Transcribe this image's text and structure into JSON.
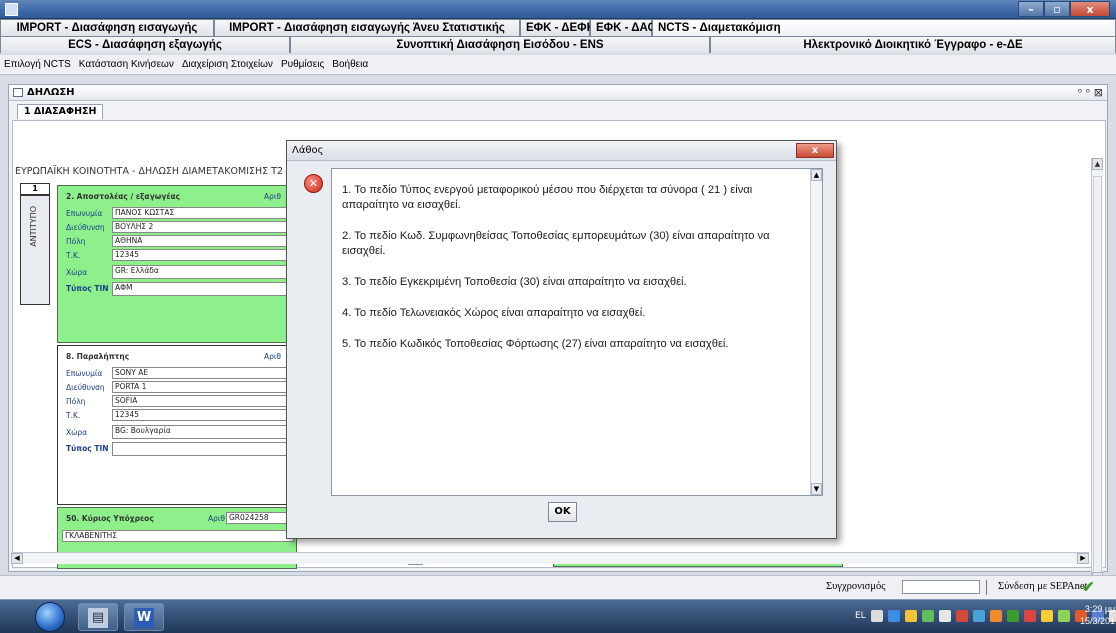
{
  "window": {
    "controls": [
      "–",
      "▫",
      "x"
    ]
  },
  "tabs_row1": [
    "IMPORT - Διασάφηση εισαγωγής",
    "IMPORT - Διασάφηση εισαγωγής Άνευ Στατιστικής",
    "ΕΦΚ - ΔΕΦΚ",
    "ΕΦΚ - ΔΑΟ",
    "NCTS - Διαμετακόμιση"
  ],
  "tabs_row2": [
    "ECS - Διασάφηση εξαγωγής",
    "Συνοπτική Διασάφηση Εισόδου - ENS",
    "Ηλεκτρονικό Διοικητικό Έγγραφο - e-ΔΕ"
  ],
  "menu": [
    "Επιλογή NCTS",
    "Κατάσταση Κινήσεων",
    "Διαχείριση Στοιχείων",
    "Ρυθμίσεις",
    "Βοήθεια"
  ],
  "inner_window": {
    "title": "ΔΗΛΩΣΗ",
    "controls": "ᵒ ᵒ ⊠",
    "subtab": "1 ΔΙΑΣΑΦΗΣΗ"
  },
  "form": {
    "headline": "ΕΥΡΩΠΑΪΚΗ ΚΟΙΝΟΤΗΤΑ - ΔΗΛΩΣΗ ΔΙΑΜΕΤΑΚΟΜΙΣΗΣ Τ2",
    "copy_number": "1",
    "copy_label": "ΑΝΤΙΤΥΠΟ",
    "sender": {
      "title": "2. Αποστολέας / εξαγωγέας",
      "num_label": "Αριθ",
      "labels": [
        "Επωνυμία",
        "Διεύθυνση",
        "Πόλη",
        "Τ.Κ.",
        "Χώρα",
        "Τύπος TIN"
      ],
      "values": [
        "ΠΑΝΟΣ ΚΩΣΤΑΣ",
        "ΒΟΥΛΗΣ 2",
        "ΑΘΗΝΑ",
        "12345",
        "GR: Ελλάδα",
        "ΑΦΜ"
      ]
    },
    "receiver": {
      "title": "8. Παραλήπτης",
      "num_label": "Αριθ",
      "labels": [
        "Επωνυμία",
        "Διεύθυνση",
        "Πόλη",
        "Τ.Κ.",
        "Χώρα",
        "Τύπος TIN"
      ],
      "values": [
        "SONY AE",
        "PORTA 1",
        "SOFIA",
        "12345",
        "BG: Βουλγαρία",
        ""
      ]
    },
    "principal": {
      "title": "50. Κύριος Υπόχρεος",
      "num_label": "Αριθ",
      "num_value": "GR024258",
      "name": "ΓΚΛΑΒΕΝΙΤΗΣ"
    }
  },
  "dialog": {
    "title": "Λάθος",
    "close": "x",
    "messages": [
      "1. Το πεδίο Τύπος ενεργού μεταφορικού μέσου που διέρχεται τα σύνορα ( 21 ) είναι απαραίτητο να εισαχθεί.",
      "2. Το πεδίο Κωδ. Συμφωνηθείσας Τοποθεσίας εμπορευμάτων (30) είναι απαραίτητο να εισαχθεί.",
      "3. Το πεδίο Εγκεκριμένη Τοποθεσία (30) είναι απαραίτητο να εισαχθεί.",
      "4. Το πεδίο Τελωνειακός Χώρος είναι απαραίτητο να εισαχθεί.",
      "5. Το πεδίο Κωδικός Τοποθεσίας Φόρτωσης (27) είναι απαραίτητο να εισαχθεί."
    ],
    "ok": "OK"
  },
  "status": {
    "sync_label": "Συγχρονισμός",
    "connection": "Σύνδεση με SEPAnet"
  },
  "taskbar": {
    "time": "3:29 μμ",
    "date": "15/3/2017",
    "lang": "EL"
  },
  "colors": {
    "form_green": "#8ef08a",
    "titlebar": "#3d6aa8",
    "error_red": "#cc2a18"
  }
}
